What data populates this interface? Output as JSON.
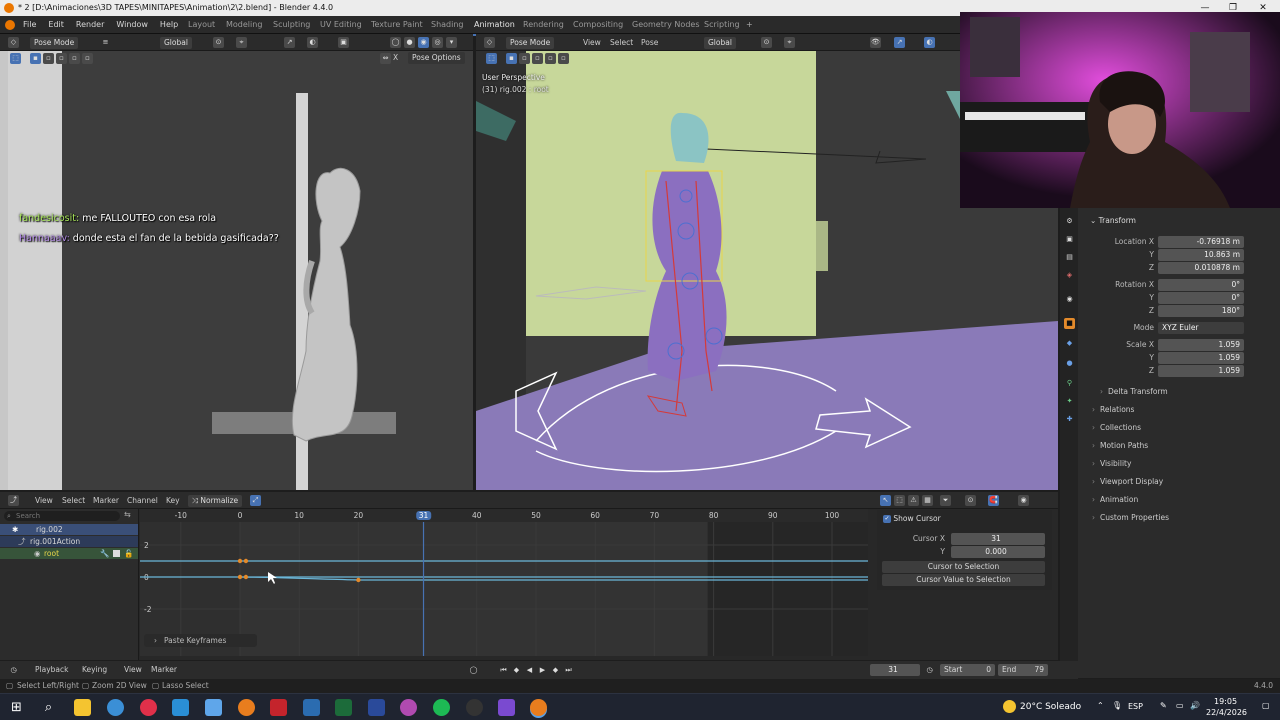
{
  "titlebar": {
    "title": "* 2 [D:\\Animaciones\\3D TAPES\\MINITAPES\\Animation\\2\\2.blend] - Blender 4.4.0",
    "min": "—",
    "max": "❐",
    "close": "✕"
  },
  "menu": [
    "File",
    "Edit",
    "Render",
    "Window",
    "Help"
  ],
  "workspaces": [
    "Layout",
    "Modeling",
    "Sculpting",
    "UV Editing",
    "Texture Paint",
    "Shading",
    "Animation",
    "Rendering",
    "Compositing",
    "Geometry Nodes",
    "Scripting"
  ],
  "active_workspace": "Animation",
  "left_view": {
    "mode": "Pose Mode",
    "orientation": "Global",
    "pose_options": "Pose Options",
    "axis_x": "X"
  },
  "right_view": {
    "mode": "Pose Mode",
    "menus": [
      "View",
      "Select",
      "Pose"
    ],
    "orientation": "Global",
    "overlay_title": "User Perspective",
    "overlay_sub": "(31) rig.002 : root"
  },
  "chat": [
    {
      "user": "fandesicosit:",
      "text": " me FALLOUTEO con esa rola"
    },
    {
      "user": "Hannaaav:",
      "text": " donde esta el fan de la bebida gasificada??"
    }
  ],
  "properties": {
    "transform_title": "Transform",
    "location": {
      "label_x": "Location X",
      "x": "-0.76918 m",
      "y": "10.863 m",
      "z": "0.010878 m"
    },
    "rotation": {
      "label_x": "Rotation X",
      "x": "0°",
      "y": "0°",
      "z": "180°"
    },
    "mode": {
      "label": "Mode",
      "value": "XYZ Euler"
    },
    "scale": {
      "label_x": "Scale X",
      "x": "1.059",
      "y": "1.059",
      "z": "1.059"
    },
    "axis_y": "Y",
    "axis_z": "Z",
    "delta": "Delta Transform",
    "sections": [
      "Relations",
      "Collections",
      "Motion Paths",
      "Visibility",
      "Viewport Display",
      "Animation",
      "Custom Properties"
    ]
  },
  "graph_editor": {
    "menus": [
      "View",
      "Select",
      "Marker",
      "Channel",
      "Key"
    ],
    "normalize": "Normalize",
    "search_placeholder": "Search",
    "channels": [
      "rig.002",
      "rig.001Action",
      "root"
    ],
    "ruler": [
      "-10",
      "0",
      "10",
      "20",
      "31",
      "40",
      "50",
      "60",
      "70",
      "80",
      "90",
      "100"
    ],
    "current_frame": "31",
    "yticks": [
      "2",
      "0",
      "-2"
    ],
    "paste_label": "Paste Keyframes"
  },
  "view_panel": {
    "show_cursor": "Show Cursor",
    "cursor_x_label": "Cursor X",
    "cursor_x": "31",
    "y_label": "Y",
    "y": "0.000",
    "btn1": "Cursor to Selection",
    "btn2": "Cursor Value to Selection"
  },
  "timeline": {
    "menus": [
      "Playback",
      "Keying",
      "View",
      "Marker"
    ],
    "frame": "31",
    "start_label": "Start",
    "start": "0",
    "end_label": "End",
    "end": "79"
  },
  "statusbar": {
    "hints": [
      "Select Left/Right",
      "Zoom 2D View",
      "Lasso Select"
    ],
    "version": "4.4.0"
  },
  "taskbar": {
    "weather": "20°C Soleado",
    "lang": "ESP",
    "time": "19:05",
    "date": "22/4/2026"
  },
  "colors": {
    "accent": "#4772b3",
    "keyframe": "#e38a2b",
    "fcurve": "#6bb7d9",
    "rig_yellow": "#e8d64a",
    "floor": "#8a7ab8",
    "wall": "#c7d79a"
  }
}
